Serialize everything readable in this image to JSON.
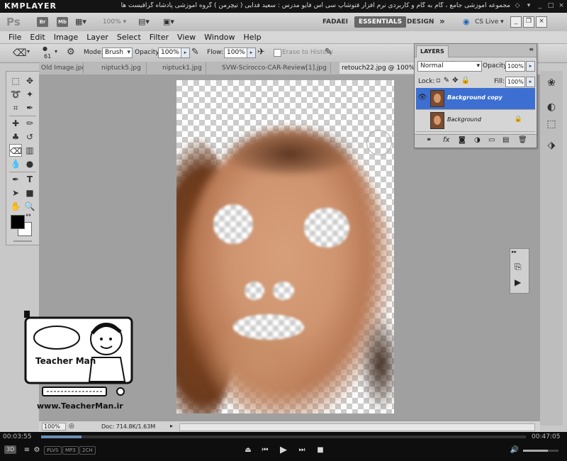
{
  "player": {
    "logo": "KMPLAYER",
    "title": "مجموعه آموزشی جامع ، گام به گام و کاربردی نرم افزار فتوشاپ سی اس فایو   مدرس : سعید فدایی ( تیچرمن ) گروه آموزشی پادشاه گرافیست ها",
    "time_elapsed": "00:03:55",
    "time_total": "00:47:05",
    "progress": 0.083,
    "volume": 0.7,
    "badges": [
      "PLVS",
      "MP3",
      "2CH"
    ],
    "mode_label": "3D"
  },
  "ps": {
    "logo": "Ps",
    "app_icons": [
      "Br",
      "Mb"
    ],
    "zoom": "100%",
    "workspaces": [
      "FADAEI",
      "ESSENTIALS",
      "DESIGN"
    ],
    "active_workspace": "ESSENTIALS",
    "more": "»",
    "cs_live": "CS Live"
  },
  "menu": [
    "File",
    "Edit",
    "Image",
    "Layer",
    "Select",
    "Filter",
    "View",
    "Window",
    "Help"
  ],
  "options": {
    "brush_size": "61",
    "mode_label": "Mode:",
    "mode_value": "Brush",
    "opacity_label": "Opacity:",
    "opacity_value": "100%",
    "flow_label": "Flow:",
    "flow_value": "100%",
    "history_label": "Erase to History"
  },
  "tabs": [
    {
      "label": "Old Image.jpg"
    },
    {
      "label": "niptuck5.jpg"
    },
    {
      "label": "niptuck1.jpg"
    },
    {
      "label": "SVW-Scirocco-CAR-Review[1].jpg"
    },
    {
      "label": "retouch22.jpg @ 100%"
    }
  ],
  "status": {
    "zoom": "100%",
    "doc": "Doc: 714.8K/1.63M"
  },
  "layers_panel": {
    "tab": "LAYERS",
    "blend_mode": "Normal",
    "opacity_label": "Opacity:",
    "opacity_value": "100%",
    "lock_label": "Lock:",
    "fill_label": "Fill:",
    "fill_value": "100%",
    "layers": [
      {
        "name": "Background copy",
        "visible": true,
        "selected": true,
        "locked": false
      },
      {
        "name": "Background",
        "visible": false,
        "selected": false,
        "locked": true
      }
    ]
  },
  "watermark": {
    "name": "Teacher Man",
    "url": "www.TeacherMan.ir"
  },
  "icons": {
    "tools": [
      "marquee-icon",
      "move-icon",
      "lasso-icon",
      "quick-select-icon",
      "crop-icon",
      "eyedropper-icon",
      "healing-icon",
      "brush-icon",
      "clone-stamp-icon",
      "history-brush-icon",
      "eraser-icon",
      "gradient-icon",
      "blur-icon",
      "dodge-icon",
      "pen-icon",
      "type-icon",
      "path-select-icon",
      "shape-icon",
      "hand-icon",
      "zoom-icon"
    ],
    "dock": [
      "styles-icon",
      "adjustments-icon",
      "masks-icon",
      "3d-icon"
    ]
  },
  "colors": {
    "selection_blue": "#3c6fd1",
    "foreground": "#000000",
    "background": "#ffffff"
  }
}
